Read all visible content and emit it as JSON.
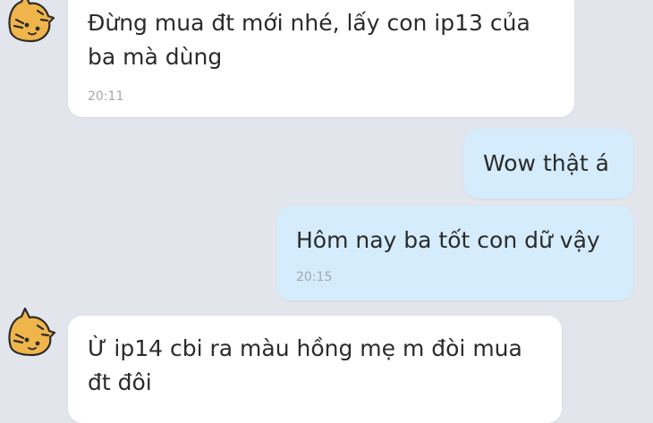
{
  "conversation": {
    "messages": [
      {
        "side": "incoming",
        "lines": [
          "Đừng mua đt mới nhé, lấy con ip13 của",
          "ba mà dùng"
        ],
        "time": "20:11"
      },
      {
        "side": "outgoing",
        "lines": [
          "Wow thật á"
        ],
        "time": ""
      },
      {
        "side": "outgoing",
        "lines": [
          "Hôm nay ba tốt con dữ vậy"
        ],
        "time": "20:15"
      },
      {
        "side": "incoming",
        "lines": [
          "Ừ ip14 cbi ra màu hồng mẹ m đòi mua",
          "đt đôi"
        ],
        "time": ""
      }
    ]
  },
  "colors": {
    "background": "#e3e5ec",
    "incoming_bubble": "#ffffff",
    "outgoing_bubble": "#d4ecfb",
    "text": "#2b2b2b",
    "timestamp": "#a4a6ab",
    "avatar_fill": "#f0b54a"
  },
  "icons": {
    "sender_avatar": "tiger-cat-sticker-icon"
  }
}
